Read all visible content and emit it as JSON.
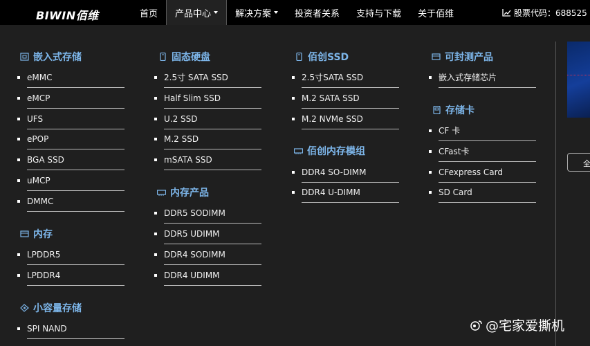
{
  "header": {
    "logo": "BIWIN佰维",
    "nav": [
      {
        "label": "首页"
      },
      {
        "label": "产品中心",
        "dropdown": true,
        "active": true
      },
      {
        "label": "解决方案",
        "dropdown": true
      },
      {
        "label": "投资者关系"
      },
      {
        "label": "支持与下载"
      },
      {
        "label": "关于佰维"
      }
    ],
    "stock_label": "股票代码：688525",
    "stock_sep": "|"
  },
  "menu": {
    "groups": [
      {
        "title": "嵌入式存储",
        "icon": "chip-icon",
        "items": [
          "eMMC",
          "eMCP",
          "UFS",
          "ePOP",
          "BGA SSD",
          "uMCP",
          "DMMC"
        ]
      },
      {
        "title": "内存",
        "icon": "memory-icon",
        "items": [
          "LPDDR5",
          "LPDDR4"
        ]
      },
      {
        "title": "小容量存储",
        "icon": "diamond-icon",
        "items": [
          "SPI NAND"
        ]
      },
      {
        "title": "固态硬盘",
        "icon": "ssd-icon",
        "items": [
          "2.5寸 SATA SSD",
          "Half Slim SSD",
          "U.2 SSD",
          "M.2 SSD",
          "mSATA SSD"
        ]
      },
      {
        "title": "内存产品",
        "icon": "ram-icon",
        "items": [
          "DDR5 SODIMM",
          "DDR5 UDIMM",
          "DDR4 SODIMM",
          "DDR4 UDIMM"
        ]
      },
      {
        "title": "佰创SSD",
        "icon": "ssd-icon",
        "items": [
          "2.5寸SATA SSD",
          "M.2 SATA SSD",
          "M.2 NVMe SSD"
        ]
      },
      {
        "title": "佰创内存模组",
        "icon": "ram-icon",
        "items": [
          "DDR4 SO-DIMM",
          "DDR4 U-DIMM"
        ]
      },
      {
        "title": "可封测产品",
        "icon": "package-icon",
        "items": [
          "嵌入式存储芯片"
        ]
      },
      {
        "title": "存储卡",
        "icon": "card-icon",
        "items": [
          "CF 卡",
          "CFast卡",
          "CFexpress Card",
          "SD Card"
        ]
      }
    ]
  },
  "side": {
    "button_label": "全"
  },
  "watermark": "@宅家爱撕机",
  "colors": {
    "header_bg": "#000000",
    "menu_bg": "#1f1f1f",
    "group_title": "#7db6ea",
    "divider": "#bdbdbd"
  }
}
